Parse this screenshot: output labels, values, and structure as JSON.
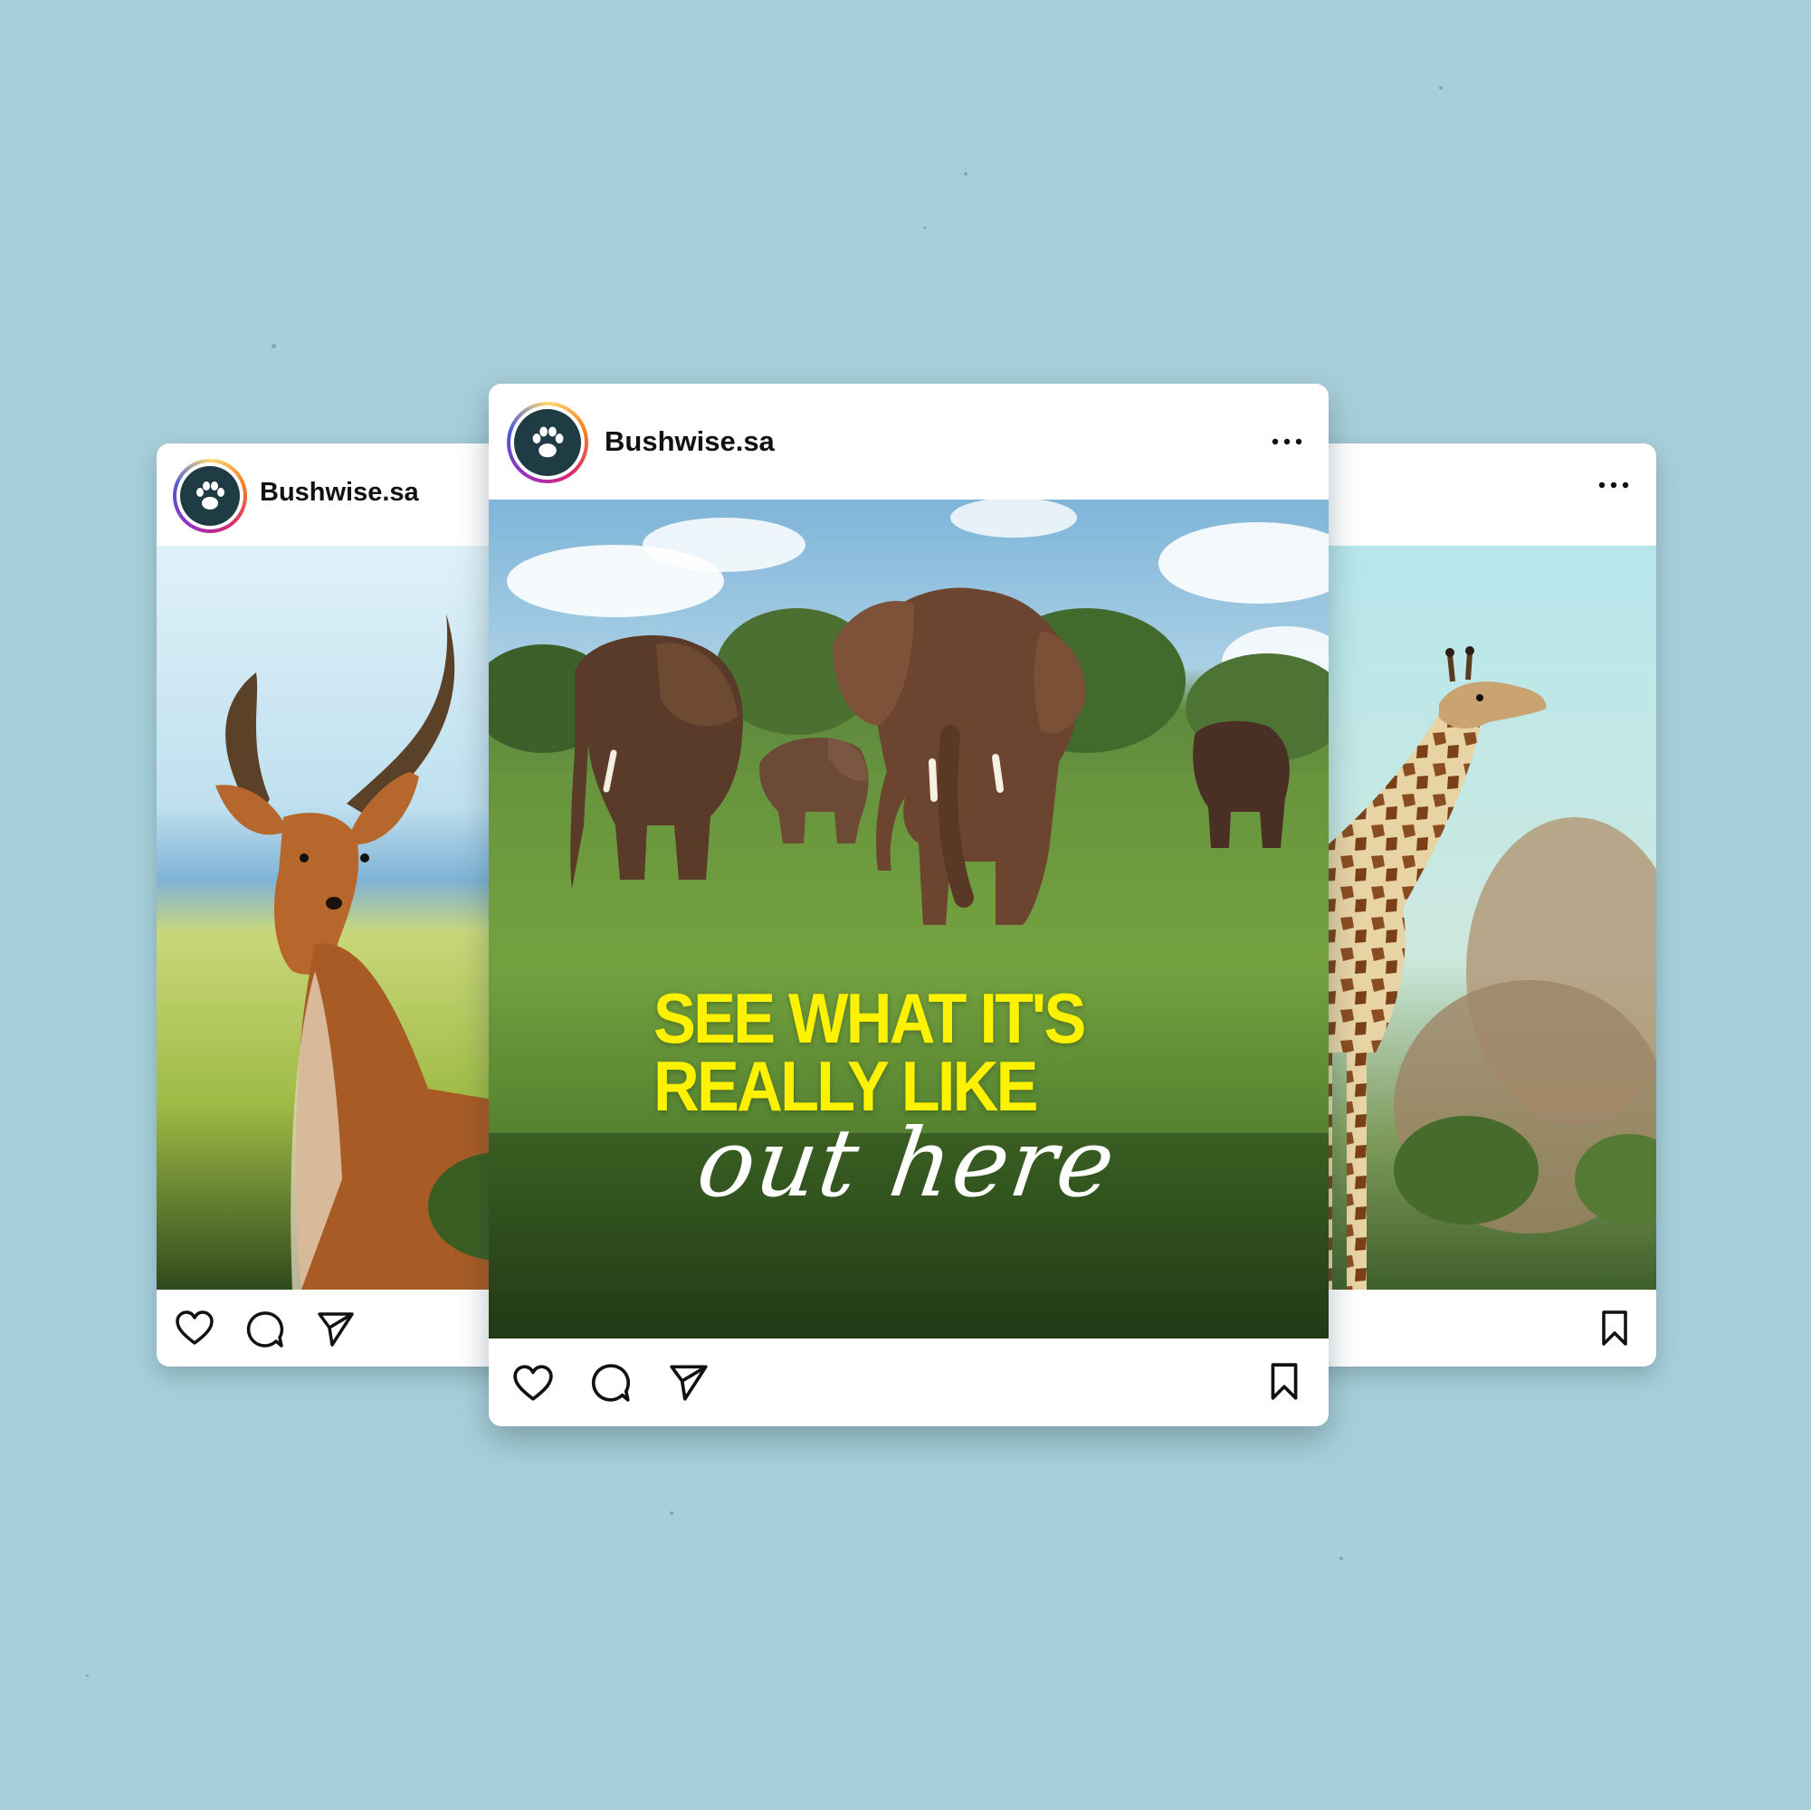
{
  "posts": {
    "left": {
      "username": "Bushwise.sa",
      "photo_subject": "impala"
    },
    "center": {
      "username": "Bushwise.sa",
      "photo_subject": "elephants",
      "overlay": {
        "line1": "SEE WHAT IT'S",
        "line2": "REALLY LIKE",
        "line3": "out here"
      }
    },
    "right": {
      "photo_subject": "giraffe"
    }
  },
  "icons": [
    "paw-logo-icon",
    "more-icon",
    "heart-icon",
    "comment-icon",
    "share-icon",
    "bookmark-icon"
  ],
  "colors": {
    "background": "#a7cfd9",
    "headline": "#fff200",
    "script": "#ffffff",
    "avatar_bg": "#1f3b44",
    "card": "#ffffff"
  }
}
